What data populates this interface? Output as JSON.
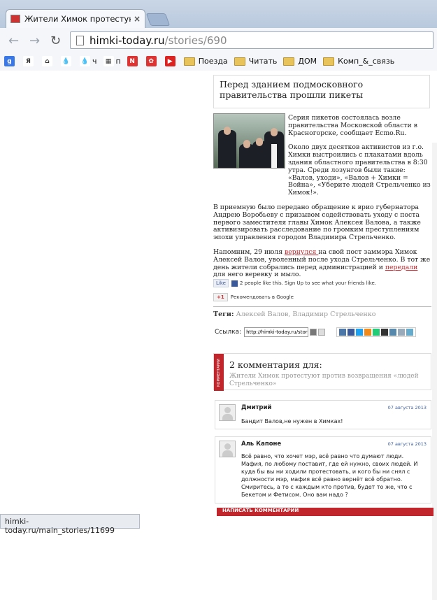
{
  "browser": {
    "tab_title": "Жители Химок протестую",
    "url_domain": "himki-today.ru",
    "url_path": "/stories/690",
    "status_url": "himki-today.ru/main_stories/11699"
  },
  "bookmarks": [
    {
      "label": "",
      "icon": "google-icon",
      "color": "#3b78e7",
      "glyph": "g"
    },
    {
      "label": "",
      "icon": "yandex-icon",
      "color": "#fff",
      "glyph": "Я"
    },
    {
      "label": "",
      "icon": "home-icon",
      "color": "#fff",
      "glyph": "⌂"
    },
    {
      "label": "",
      "icon": "drop-icon",
      "color": "#fff",
      "glyph": "💧"
    },
    {
      "label": "ч",
      "icon": "drop-icon",
      "color": "#fff",
      "glyph": "💧"
    },
    {
      "label": "п",
      "icon": "grid-icon",
      "color": "#fff",
      "glyph": "▦"
    },
    {
      "label": "",
      "icon": "flash-icon",
      "color": "#d33",
      "glyph": "N"
    },
    {
      "label": "",
      "icon": "gift-icon",
      "color": "#d33",
      "glyph": "✿"
    },
    {
      "label": "",
      "icon": "youtube-icon",
      "color": "#d22",
      "glyph": "▶"
    }
  ],
  "bookmark_folders": [
    "Поезда",
    "Читать",
    "ДОМ",
    "Комп_&_связь"
  ],
  "article": {
    "title": "Перед зданием подмосковного правительства прошли пикеты",
    "p1": "Серия пикетов состоялась возле правительства Московской области в Красногорске, сообщает Ecmo.Ru.",
    "p2": "Около двух десятков активистов из г.о. Химки выстроились с плакатами вдоль здания областного правительства в 8:30 утра. Среди лозунгов были такие: «Валов, уходи», «Валов + Химки = Война», «Уберите людей Стрельченко из Химок!».",
    "p3": "В приемную было передано обращение к врио губернатора Андрею Воробьеву с призывом содействовать уходу с поста первого заместителя главы Химок Алексея Валова, а также активизировать расследование по громким преступлениям эпохи управления городом Владимира Стрельченко.",
    "p4a": "Напомним, 29 июля ",
    "p4link1": "вернулся ",
    "p4b": "на свой пост заммэра Химок Алексей Валов, уволенный после ухода Стрельченко. В тот же день жители собрались перед администрацией и ",
    "p4link2": "передали",
    "p4c": " для него веревку и мыло."
  },
  "social": {
    "like_label": "Like",
    "like_text": "2 people like this. Sign Up to see what your friends like.",
    "gplus_label": "+1",
    "gplus_text": "Рекомендовать в Google"
  },
  "tags": {
    "label": "Теги:",
    "values": "Алексей Валов, Владимир Стрельченко"
  },
  "share": {
    "label": "Ссылка:",
    "value": "http://himki-today.ru/stories"
  },
  "comments_header": {
    "side": "КОММЕНТАРИИ",
    "title": "2 комментария для:",
    "subtitle": "Жители Химок протестуют против возвращения «людей Стрельченко»"
  },
  "comments": [
    {
      "author": "Дмитрий",
      "date": "07 августа 2013",
      "text": "Бандит Валов,не нужен в Химках!"
    },
    {
      "author": "Аль Капоне",
      "date": "07 августа 2013",
      "text": "Всё равно, что хочет мэр, всё равно что думают люди. Мафия, по любому поставит, где ей нужно, своих людей. И куда бы вы ни ходили протестовать, и кого бы ни снял с должности мэр, мафия всё равно вернёт всё обратно. Смиритесь, а то с каждым кто против, будет то же, что с Бекетом и Фетисом. Оно вам надо ?"
    }
  ],
  "write_comment": "НАПИСАТЬ КОММЕНТАРИЙ"
}
